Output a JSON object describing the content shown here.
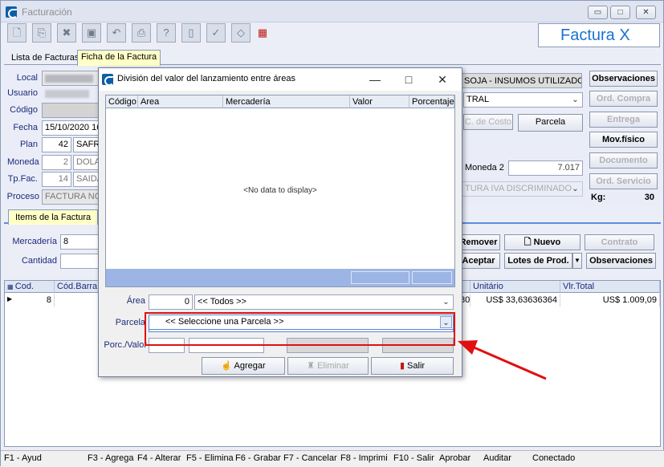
{
  "window": {
    "title": "Facturación",
    "min": "▭",
    "max": "□",
    "close": "✕"
  },
  "toolbar": {
    "icons": [
      "new-icon",
      "copy-icon",
      "delete-icon",
      "save-icon",
      "undo-icon",
      "print-icon",
      "help-icon",
      "document-icon",
      "check-icon",
      "eraser-icon",
      "calculator-icon"
    ]
  },
  "logo": {
    "text": "Factura X",
    "suffix": "."
  },
  "tabs": {
    "list": "Lista de Facturas",
    "sheet": "Ficha de la Factura"
  },
  "form": {
    "local_label": "Local",
    "usuario_label": "Usuario",
    "codigo_label": "Código",
    "fecha_label": "Fecha",
    "fecha_value": "15/10/2020 16",
    "plan_label": "Plan",
    "plan_num": "42",
    "plan_text": "SAFRA",
    "moneda_label": "Moneda",
    "moneda_num": "2",
    "moneda_text": "DOLA",
    "tpfac_label": "Tp.Fac.",
    "tpfac_num": "14",
    "tpfac_text": "SAIDA",
    "proceso_label": "Proceso",
    "proceso_text": "FACTURA NOR",
    "insumos": "SOJA - INSUMOS UTILIZADOS",
    "tral": "TRAL",
    "c_costo": "C. de Costo",
    "parcela_btn": "Parcela",
    "moneda2_label": "Moneda 2",
    "moneda2_value": "7.017",
    "iva": "TURA IVA DISCRIMINADO",
    "kg_label": "Kg:",
    "kg_value": "30"
  },
  "side_buttons": {
    "observaciones": "Observaciones",
    "ord_compra": "Ord. Compra",
    "entrega": "Entrega",
    "mov_fisico": "Mov.físico",
    "documento": "Documento",
    "ord_servicio": "Ord. Servicio"
  },
  "items_tab": "Items de la Factura",
  "items": {
    "mercaderia_label": "Mercadería",
    "mercaderia_value": "8",
    "cantidad_label": "Cantidad",
    "remover": "Remover",
    "nuevo": "Nuevo",
    "contrato": "Contrato",
    "aceptar": "Aceptar",
    "lotes": "Lotes de Prod.",
    "observaciones": "Observaciones"
  },
  "grid": {
    "headers": [
      "Cod.",
      "Cód.Barra",
      "Unitário",
      "Vlr.Total"
    ],
    "row": {
      "cod": "8",
      "col80": "80",
      "unitario": "US$ 33,63636364",
      "total": "US$ 1.009,09"
    }
  },
  "status": [
    "F1 - Ayud",
    "F3 - Agrega",
    "F4 - Alterar",
    "F5 - Elimina",
    "F6 - Grabar",
    "F7 - Cancelar",
    "F8 - Imprimi",
    "F10 - Salir",
    "Aprobar",
    "Auditar",
    "Conectado"
  ],
  "dialog": {
    "title": "División del valor del lanzamiento entre áreas",
    "grid_headers": [
      "Código",
      "Area",
      "Mercadería",
      "Valor",
      "Porcentaje"
    ],
    "no_data": "<No data to display>",
    "area_label": "Área",
    "area_num": "0",
    "area_value": "<< Todos >>",
    "parcela_label": "Parcela",
    "parcela_value": "<< Seleccione una Parcela >>",
    "porc_label": "Porc./Valor",
    "agregar": "Agregar",
    "eliminar": "Eliminar",
    "salir": "Salir"
  }
}
